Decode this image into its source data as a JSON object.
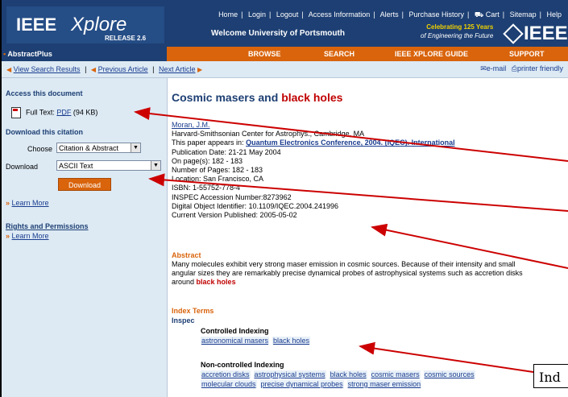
{
  "header": {
    "logo_ieee": "IEEE",
    "logo_xplore": "Xplore",
    "logo_release": "RELEASE 2.6",
    "topnav": [
      "Home",
      "Login",
      "Logout",
      "Access Information",
      "Alerts",
      "Purchase History",
      "Cart",
      "Sitemap",
      "Help"
    ],
    "welcome": "Welcome University of Portsmouth",
    "celebrating": "Celebrating 125 Years",
    "celebrating_sub": "of Engineering the Future",
    "ieee_right": "IEEE"
  },
  "tabs": {
    "abstractplus": "AbstractPlus",
    "browse": "BROWSE",
    "search": "SEARCH",
    "guide": "IEEE XPLORE GUIDE",
    "support": "SUPPORT"
  },
  "nav": {
    "view_results": "View Search Results",
    "prev_article": "Previous Article",
    "next_article": "Next Article",
    "email": "e-mail",
    "printer": "printer friendly"
  },
  "sidebar": {
    "access_heading": "Access this document",
    "fulltext_label": "Full Text:",
    "pdf_link": "PDF",
    "pdf_size": "(94 KB)",
    "download_heading": "Download this citation",
    "choose_label": "Choose",
    "choose_value": "Citation & Abstract",
    "download_label": "Download",
    "download_value": "ASCII Text",
    "download_button": "Download",
    "learn_more_1": "Learn More",
    "rights_heading": "Rights and Permissions",
    "learn_more_2": "Learn More"
  },
  "article": {
    "title_part1": "Cosmic masers and",
    "title_part2": "black holes",
    "author": "Moran, J.M.",
    "affiliation": "Harvard-Smithsonian Center for Astrophys., Cambridge, MA",
    "appears_in_label": "This paper appears in:",
    "conference": "Quantum Electronics Conference, 2004. (IQEC). International",
    "pub_date": "Publication Date: 21-21 May 2004",
    "pages": "On page(s): 182 - 183",
    "num_pages": "Number of Pages: 182 - 183",
    "location": "Location: San Francisco, CA",
    "isbn": "ISBN: 1-55752-778-4",
    "inspec": "INSPEC Accession Number:8273962",
    "doi": "Digital Object Identifier: 10.1109/IQEC.2004.241996",
    "version": "Current Version Published: 2005-05-02"
  },
  "abstract": {
    "heading": "Abstract",
    "line1": "Many molecules exhibit very strong maser emission in cosmic sources. Because of their intensity and small",
    "line2": "angular sizes they are remarkably precise dynamical probes of astrophysical systems such as accretion disks",
    "line3_pre": "around",
    "line3_hl": "black holes"
  },
  "index_terms": {
    "heading": "Index Terms",
    "inspec": "Inspec",
    "controlled_heading": "Controlled Indexing",
    "controlled": [
      "astronomical masers",
      "black holes"
    ],
    "noncontrolled_heading": "Non-controlled Indexing",
    "noncontrolled_row1": [
      "accretion disks",
      "astrophysical systems",
      "black holes",
      "cosmic masers",
      "cosmic sources"
    ],
    "noncontrolled_row2": [
      "molecular clouds",
      "precise dynamical probes",
      "strong maser emission"
    ]
  },
  "annotation": {
    "label": "Ind"
  },
  "colors": {
    "header_blue": "#1d3f73",
    "tab_orange": "#d9640c",
    "sidebar_bg": "#ddeaf4",
    "highlight_red": "#c00000",
    "arrow_red": "#cc0000"
  }
}
